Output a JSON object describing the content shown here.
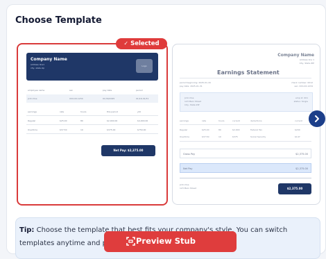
{
  "section_title": "Choose Template",
  "selected_badge": "Selected",
  "template1": {
    "company_name": "Company Name",
    "addr1": "address line1",
    "addr2": "city, state zip",
    "logo": "Logo",
    "info_headers": [
      "employee name",
      "ssn",
      "pay date",
      "period"
    ],
    "info_values": [
      "John Doe",
      "XXX-XX-1234",
      "01/30/2025",
      "01/16-01/31"
    ],
    "earn_headers": [
      "earnings",
      "rate",
      "hours",
      "this period",
      "ytd"
    ],
    "earn_rows": [
      [
        "Regular",
        "$25.00",
        "80",
        "$2,000.00",
        "$4,000.00"
      ],
      [
        "Overtime",
        "$37.50",
        "10",
        "$375.00",
        "$750.00"
      ]
    ],
    "net_pay": "Net Pay: $2,375.00"
  },
  "template2": {
    "company_name": "Company Name",
    "addr1": "Address line 1",
    "addr2": "City, State ZIP",
    "heading": "Earnings Statement",
    "meta_left1": "period beginning: 2025-01-16",
    "meta_left2": "pay date: 2025-01-31",
    "meta_right1": "check number: 0012",
    "meta_right2": "ssn: XXX-XX-1234",
    "emp_lines": [
      "John Doe",
      "123 Main Street",
      "City, State ZIP"
    ],
    "emp_right": [
      "emp id: 001",
      "status: Single"
    ],
    "table_headers": [
      "earnings",
      "rate",
      "hours",
      "current",
      "deductions",
      "current"
    ],
    "table_rows": [
      [
        "Regular",
        "$25.00",
        "80",
        "$2,000",
        "Federal Tax",
        "$200"
      ],
      [
        "Overtime",
        "$37.50",
        "10",
        "$375",
        "Social Security",
        "$147"
      ]
    ],
    "gross_label": "Gross Pay",
    "gross_value": "$2,375.00",
    "net_label": "Net Pay",
    "net_value": "$2,375.00",
    "footer1": "John Doe",
    "footer2": "123 Main Street",
    "net_badge": "$2,375.00"
  },
  "tip": {
    "bold": "Tip:",
    "text": "Choose the template that best fits your company's style. You can switch templates anytime and preview before download."
  },
  "preview_button": "Preview Stub",
  "colors": {
    "accent": "#df3b3b",
    "navy": "#1f3767",
    "tip_bg": "#eaf1fb"
  }
}
